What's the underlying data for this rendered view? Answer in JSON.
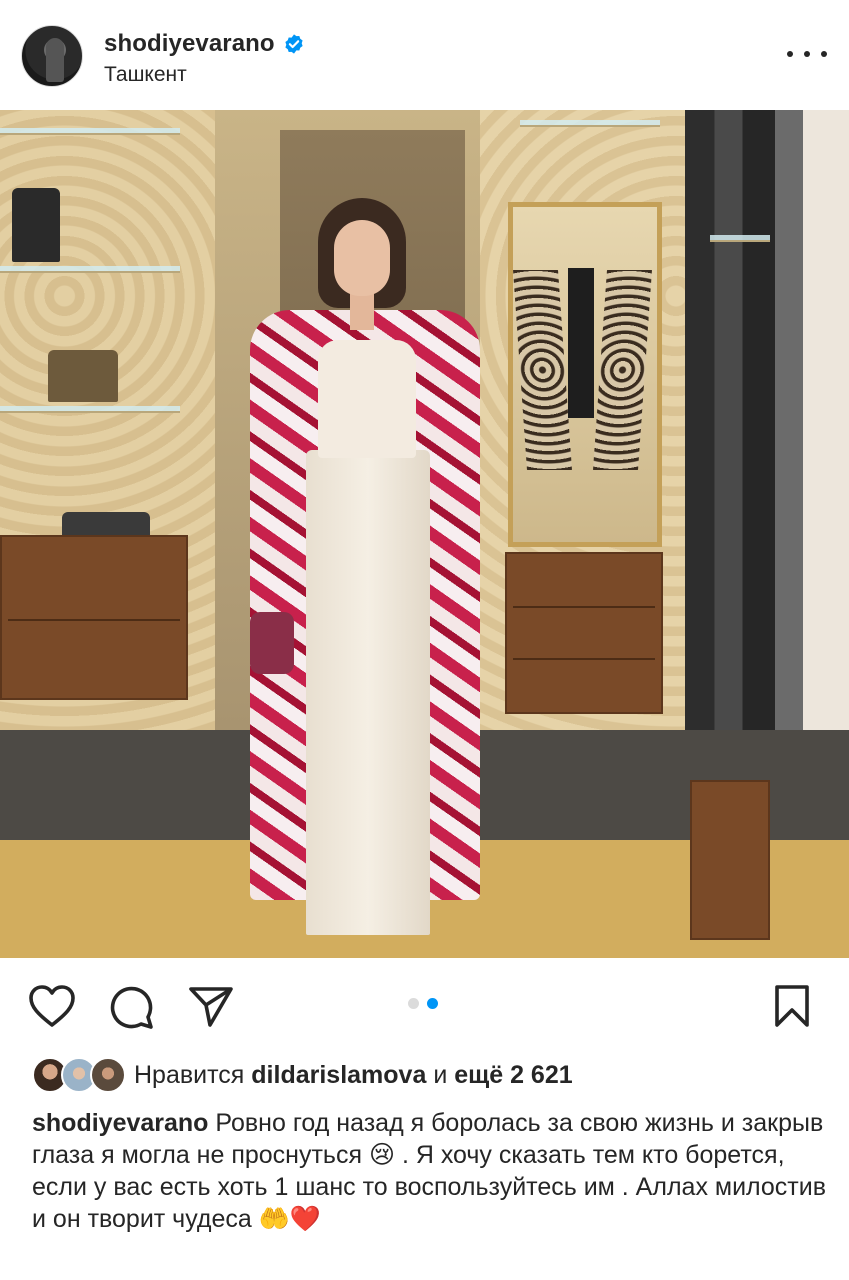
{
  "post": {
    "username": "shodiyevarano",
    "location": "Ташкент",
    "verified": true,
    "more_icon": "more-horizontal-icon"
  },
  "carousel": {
    "total": 2,
    "active": 2
  },
  "actions": {
    "like_icon": "heart-icon",
    "comment_icon": "comment-icon",
    "share_icon": "paper-plane-icon",
    "save_icon": "bookmark-icon"
  },
  "likes": {
    "prefix": "Нравится",
    "user": "dildarislamova",
    "connector": "и",
    "others": "ещё 2 621"
  },
  "caption": {
    "username": "shodiyevarano",
    "text": "Ровно год назад я боролась за свою жизнь и закрыв глаза я могла не проснуться 😢 . Я хочу сказать тем кто борется, если у вас есть хоть 1 шанс то воспользуйтесь им . Аллах милостив и он творит чудеса 🤲❤️"
  },
  "colors": {
    "text": "#262626",
    "verified": "#0095f6",
    "dot_active": "#0095f6",
    "dot_inactive": "#dbdbdb"
  }
}
